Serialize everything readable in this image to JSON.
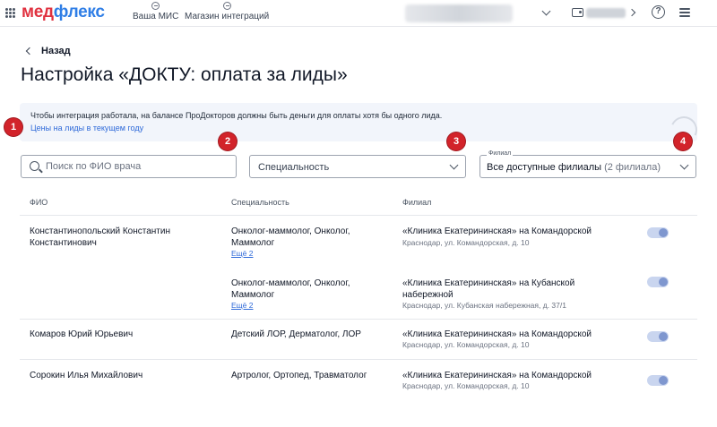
{
  "app": {
    "logo_part1": "мед",
    "logo_part2": "флекс",
    "nav": [
      {
        "label": "Ваша МИС"
      },
      {
        "label": "Магазин интеграций"
      }
    ],
    "help_label": "?"
  },
  "header": {
    "back_label": "Назад",
    "title": "Настройка «ДОКТУ: оплата за лиды»"
  },
  "banner": {
    "text": "Чтобы интеграция работала, на балансе ПроДокторов должны быть деньги для оплаты хотя бы одного лида.",
    "link": "Цены на лиды в текущем году"
  },
  "badges": [
    "1",
    "2",
    "3",
    "4"
  ],
  "filters": {
    "search_placeholder": "Поиск по ФИО врача",
    "specialty_value": "Специальность",
    "branch_label": "Филиал",
    "branch_value": "Все доступные филиалы",
    "branch_count": "(2 филиала)"
  },
  "table": {
    "headers": {
      "name": "ФИО",
      "specialty": "Специальность",
      "branch": "Филиал"
    },
    "rows": [
      {
        "name": "Константинопольский Константин Константинович",
        "entries": [
          {
            "specialty": "Онколог-маммолог, Онколог, Маммолог",
            "more": "Ещё 2",
            "branch": "«Клиника Екатерининская» на Командорской",
            "address": "Краснодар, ул. Командорская, д. 10",
            "enabled": true
          },
          {
            "specialty": "Онколог-маммолог, Онколог, Маммолог",
            "more": "Ещё 2",
            "branch": "«Клиника Екатерининская» на Кубанской набережной",
            "address": "Краснодар, ул. Кубанская набережная, д. 37/1",
            "enabled": true
          }
        ]
      },
      {
        "name": "Комаров Юрий Юрьевич",
        "entries": [
          {
            "specialty": "Детский ЛОР, Дерматолог, ЛОР",
            "branch": "«Клиника Екатерининская» на Командорской",
            "address": "Краснодар, ул. Командорская, д. 10",
            "enabled": true
          }
        ]
      },
      {
        "name": "Сорокин Илья Михайлович",
        "entries": [
          {
            "specialty": "Артролог, Ортопед, Травматолог",
            "branch": "«Клиника Екатерининская» на Командорской",
            "address": "Краснодар, ул. Командорская, д. 10",
            "enabled": true
          }
        ]
      }
    ]
  },
  "colors": {
    "brand_red": "#e0313f",
    "brand_blue": "#2f7ee6",
    "link": "#2f6ad9",
    "badge": "#d2232a",
    "banner_bg": "#f2f5fb"
  }
}
